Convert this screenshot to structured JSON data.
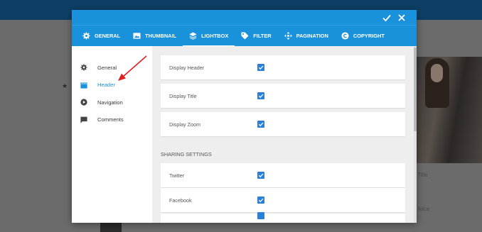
{
  "modal": {
    "header": {
      "ok_icon": "checkmark-icon",
      "close_icon": "close-icon"
    },
    "tabs": [
      {
        "label": "General",
        "icon": "gear-icon",
        "active": false
      },
      {
        "label": "Thumbnail",
        "icon": "image-icon",
        "active": false
      },
      {
        "label": "Lightbox",
        "icon": "layers-icon",
        "active": true
      },
      {
        "label": "Filter",
        "icon": "tag-icon",
        "active": false
      },
      {
        "label": "Pagination",
        "icon": "move-arrows-icon",
        "active": false
      },
      {
        "label": "Copyright",
        "icon": "copyright-icon",
        "active": false
      }
    ],
    "sidebar": {
      "items": [
        {
          "label": "General",
          "icon": "gear-icon",
          "active": false
        },
        {
          "label": "Header",
          "icon": "clapperboard-icon",
          "active": true
        },
        {
          "label": "Navigation",
          "icon": "play-circle-icon",
          "active": false
        },
        {
          "label": "Comments",
          "icon": "comment-icon",
          "active": false
        }
      ]
    },
    "settings": {
      "display_header": {
        "label": "Display Header",
        "checked": true
      },
      "display_title": {
        "label": "Display Title",
        "checked": true
      },
      "display_zoom": {
        "label": "Display Zoom",
        "checked": true
      },
      "sharing_title": "Sharing Settings",
      "twitter": {
        "label": "Twitter",
        "checked": true
      },
      "facebook": {
        "label": "Facebook",
        "checked": true
      }
    }
  },
  "background": {
    "caption_1": "Title",
    "caption_2": "Alice"
  },
  "colors": {
    "accent": "#1a91db",
    "checkbox": "#2b7fd4",
    "annotation_arrow": "#e02020",
    "top_bar": "#0d3f64"
  }
}
